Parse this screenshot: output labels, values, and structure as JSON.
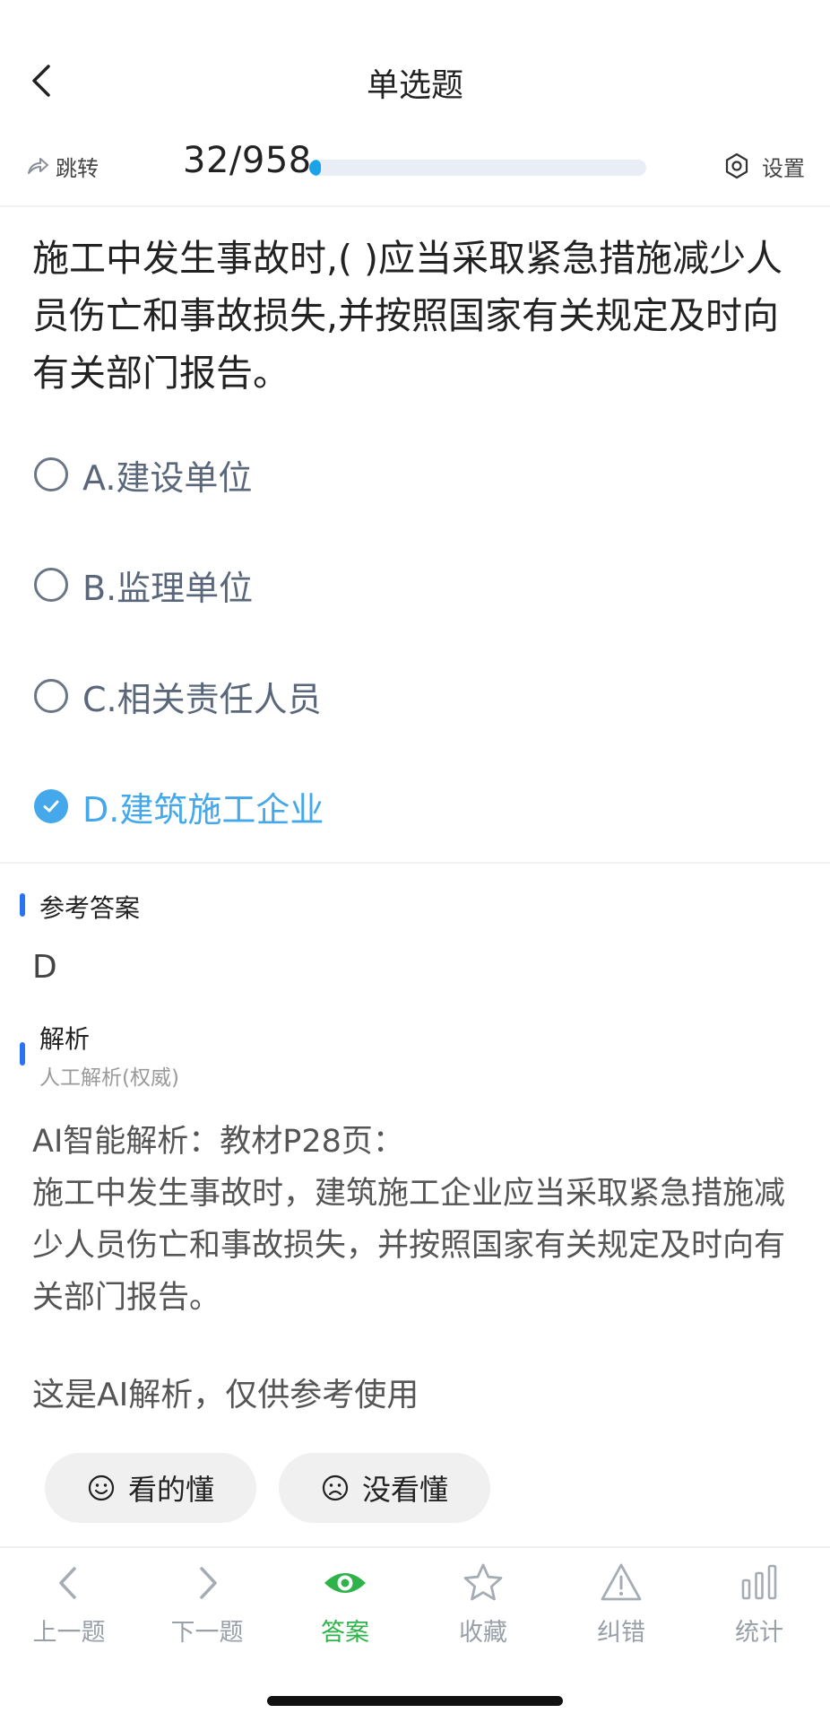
{
  "header": {
    "title": "单选题"
  },
  "toolbar": {
    "jump_label": "跳转",
    "counter": "32/958",
    "progress_fraction": 0.0334,
    "settings_label": "设置"
  },
  "question": {
    "text": "施工中发生事故时,( )应当采取紧急措施减少人员伤亡和事故损失,并按照国家有关规定及时向有关部门报告。",
    "options": [
      {
        "label": "A.建设单位",
        "selected": false
      },
      {
        "label": "B.监理单位",
        "selected": false
      },
      {
        "label": "C.相关责任人员",
        "selected": false
      },
      {
        "label": "D.建筑施工企业",
        "selected": true
      }
    ]
  },
  "answer": {
    "title": "参考答案",
    "value": "D"
  },
  "analysis": {
    "title": "解析",
    "subtitle": "人工解析(权威)",
    "text_line1": "AI智能解析：教材P28页：",
    "text_body": "施工中发生事故时，建筑施工企业应当采取紧急措施减少人员伤亡和事故损失，并按照国家有关规定及时向有关部门报告。",
    "note": "这是AI解析，仅供参考使用"
  },
  "feedback": {
    "understood_label": "看的懂",
    "not_understood_label": "没看懂"
  },
  "bottom_nav": {
    "items": [
      {
        "label": "上一题",
        "icon": "chevron-left-icon"
      },
      {
        "label": "下一题",
        "icon": "chevron-right-icon"
      },
      {
        "label": "答案",
        "icon": "eye-icon",
        "active": true
      },
      {
        "label": "收藏",
        "icon": "star-icon"
      },
      {
        "label": "纠错",
        "icon": "warning-icon"
      },
      {
        "label": "统计",
        "icon": "bar-chart-icon"
      }
    ]
  },
  "colors": {
    "accent_blue": "#44a8ea",
    "progress_blue": "#1aa3e8",
    "section_bar_blue": "#2a73f0",
    "active_green": "#2eb24a"
  }
}
